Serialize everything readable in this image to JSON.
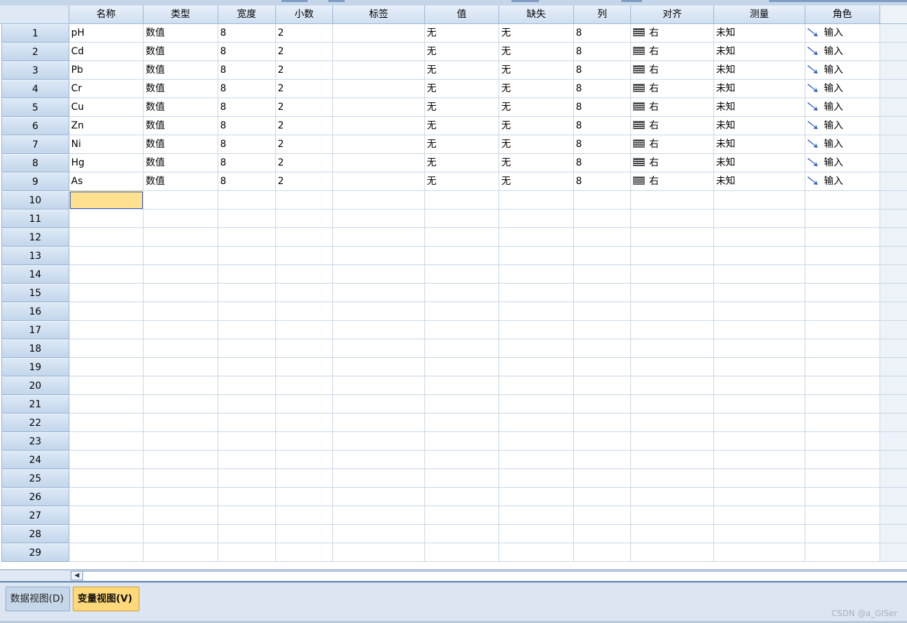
{
  "columns": [
    {
      "key": "name",
      "label": "名称",
      "width": 110
    },
    {
      "key": "type",
      "label": "类型",
      "width": 110
    },
    {
      "key": "width",
      "label": "宽度",
      "width": 85
    },
    {
      "key": "decimals",
      "label": "小数",
      "width": 85
    },
    {
      "key": "label",
      "label": "标签",
      "width": 135
    },
    {
      "key": "values",
      "label": "值",
      "width": 110
    },
    {
      "key": "missing",
      "label": "缺失",
      "width": 110
    },
    {
      "key": "columns",
      "label": "列",
      "width": 85
    },
    {
      "key": "align",
      "label": "对齐",
      "width": 122
    },
    {
      "key": "measure",
      "label": "测量",
      "width": 135
    },
    {
      "key": "role",
      "label": "角色",
      "width": 110
    }
  ],
  "rows": [
    {
      "num": "1",
      "name": "pH",
      "type": "数值",
      "width": "8",
      "decimals": "2",
      "label": "",
      "values": "无",
      "missing": "无",
      "columns": "8",
      "align": "右",
      "measure": "未知",
      "role": "输入"
    },
    {
      "num": "2",
      "name": "Cd",
      "type": "数值",
      "width": "8",
      "decimals": "2",
      "label": "",
      "values": "无",
      "missing": "无",
      "columns": "8",
      "align": "右",
      "measure": "未知",
      "role": "输入"
    },
    {
      "num": "3",
      "name": "Pb",
      "type": "数值",
      "width": "8",
      "decimals": "2",
      "label": "",
      "values": "无",
      "missing": "无",
      "columns": "8",
      "align": "右",
      "measure": "未知",
      "role": "输入"
    },
    {
      "num": "4",
      "name": "Cr",
      "type": "数值",
      "width": "8",
      "decimals": "2",
      "label": "",
      "values": "无",
      "missing": "无",
      "columns": "8",
      "align": "右",
      "measure": "未知",
      "role": "输入"
    },
    {
      "num": "5",
      "name": "Cu",
      "type": "数值",
      "width": "8",
      "decimals": "2",
      "label": "",
      "values": "无",
      "missing": "无",
      "columns": "8",
      "align": "右",
      "measure": "未知",
      "role": "输入"
    },
    {
      "num": "6",
      "name": "Zn",
      "type": "数值",
      "width": "8",
      "decimals": "2",
      "label": "",
      "values": "无",
      "missing": "无",
      "columns": "8",
      "align": "右",
      "measure": "未知",
      "role": "输入"
    },
    {
      "num": "7",
      "name": "Ni",
      "type": "数值",
      "width": "8",
      "decimals": "2",
      "label": "",
      "values": "无",
      "missing": "无",
      "columns": "8",
      "align": "右",
      "measure": "未知",
      "role": "输入"
    },
    {
      "num": "8",
      "name": "Hg",
      "type": "数值",
      "width": "8",
      "decimals": "2",
      "label": "",
      "values": "无",
      "missing": "无",
      "columns": "8",
      "align": "右",
      "measure": "未知",
      "role": "输入"
    },
    {
      "num": "9",
      "name": "As",
      "type": "数值",
      "width": "8",
      "decimals": "2",
      "label": "",
      "values": "无",
      "missing": "无",
      "columns": "8",
      "align": "右",
      "measure": "未知",
      "role": "输入"
    }
  ],
  "empty_row_numbers": [
    "10",
    "11",
    "12",
    "13",
    "14",
    "15",
    "16",
    "17",
    "18",
    "19",
    "20",
    "21",
    "22",
    "23",
    "24",
    "25",
    "26",
    "27",
    "28",
    "29"
  ],
  "active_cell": {
    "row": "10",
    "column": "name"
  },
  "tabs": {
    "data_view": "数据视图(D)",
    "variable_view": "变量视图(V)",
    "active": "variable_view"
  },
  "watermark": "CSDN @a_GISer",
  "colors": {
    "active_cell": "#ffe190",
    "active_tab": "#ffd87a",
    "role_icon": "#1f4fbf"
  }
}
